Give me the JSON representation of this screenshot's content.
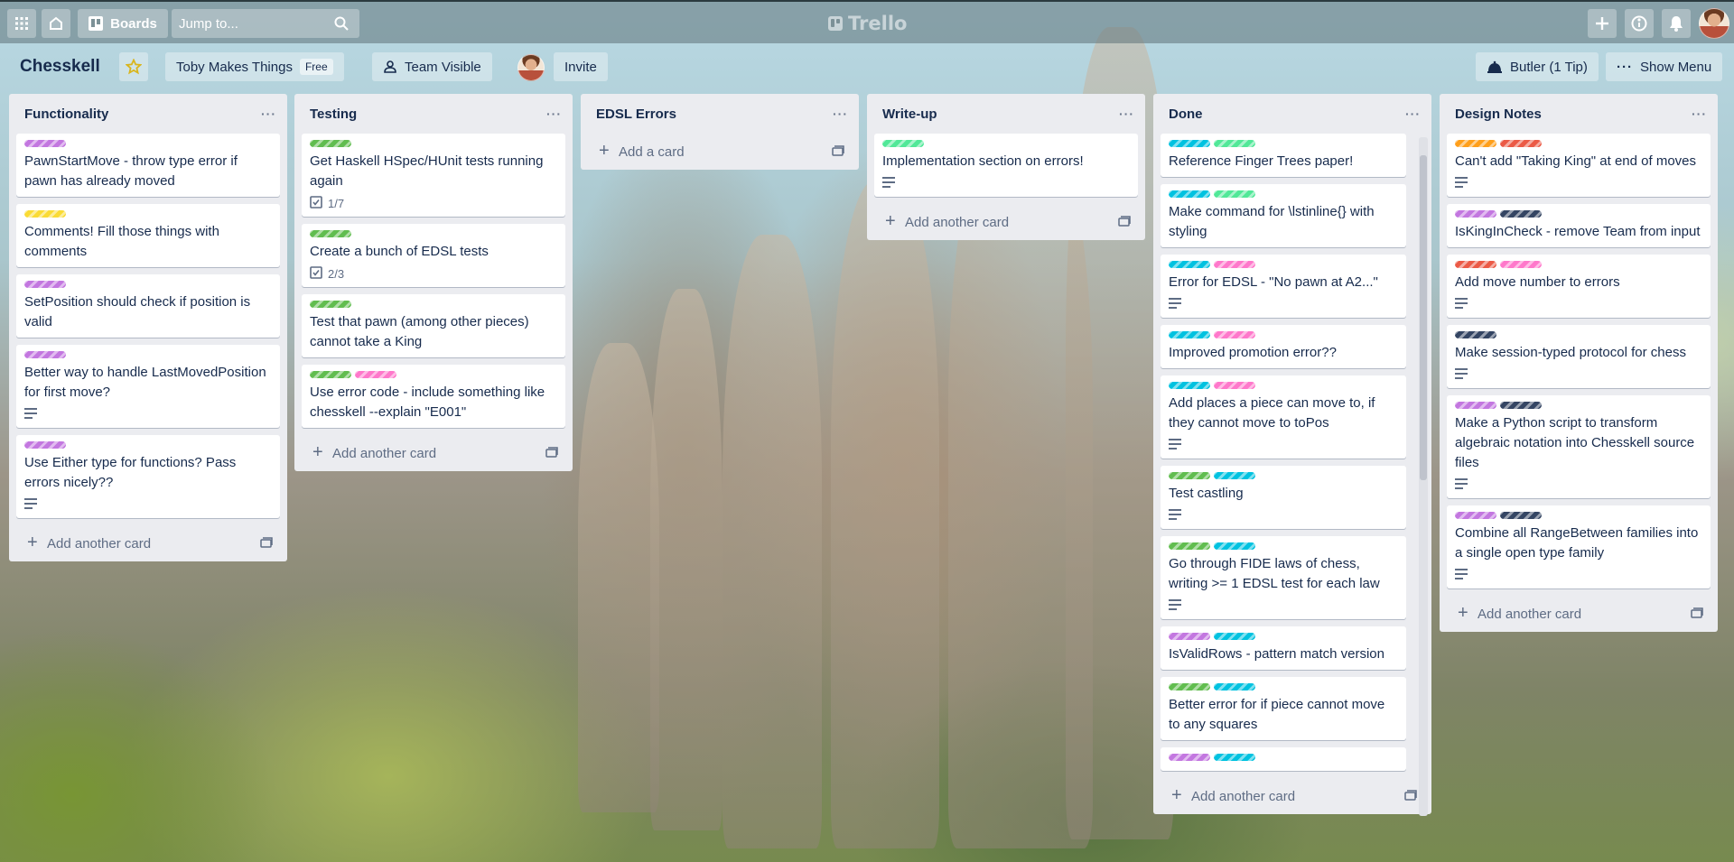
{
  "header": {
    "boards_label": "Boards",
    "search_placeholder": "Jump to...",
    "logo": "Trello"
  },
  "board": {
    "title": "Chesskell",
    "team_name": "Toby Makes Things",
    "team_plan": "Free",
    "visibility": "Team Visible",
    "invite_label": "Invite",
    "butler_label": "Butler (1 Tip)",
    "show_menu_label": "Show Menu"
  },
  "label_colors": {
    "purple": "#c377e0",
    "yellow": "#fadb35",
    "green": "#61bd4f",
    "pink": "#ff78cb",
    "mint": "#51e898",
    "sky": "#00c2e0",
    "navy": "#344563",
    "orange": "#ff9f1a",
    "red": "#eb5a46"
  },
  "lists": [
    {
      "title": "Functionality",
      "add_label": "Add another card",
      "cards": [
        {
          "labels": [
            "purple"
          ],
          "title": "PawnStartMove - throw type error if pawn has already moved"
        },
        {
          "labels": [
            "yellow"
          ],
          "title": "Comments! Fill those things with comments"
        },
        {
          "labels": [
            "purple"
          ],
          "title": "SetPosition should check if position is valid"
        },
        {
          "labels": [
            "purple"
          ],
          "title": "Better way to handle LastMovedPosition for first move?",
          "description": true
        },
        {
          "labels": [
            "purple"
          ],
          "title": "Use Either type for functions? Pass errors nicely??",
          "description": true
        }
      ]
    },
    {
      "title": "Testing",
      "add_label": "Add another card",
      "cards": [
        {
          "labels": [
            "green"
          ],
          "title": "Get Haskell HSpec/HUnit tests running again",
          "checklist": "1/7"
        },
        {
          "labels": [
            "green"
          ],
          "title": "Create a bunch of EDSL tests",
          "checklist": "2/3"
        },
        {
          "labels": [
            "green"
          ],
          "title": "Test that pawn (among other pieces) cannot take a King"
        },
        {
          "labels": [
            "green",
            "pink"
          ],
          "title": "Use error code - include something like chesskell --explain \"E001\""
        }
      ]
    },
    {
      "title": "EDSL Errors",
      "add_label": "Add a card",
      "cards": []
    },
    {
      "title": "Write-up",
      "add_label": "Add another card",
      "cards": [
        {
          "labels": [
            "mint"
          ],
          "title": "Implementation section on errors!",
          "description": true
        }
      ]
    },
    {
      "title": "Done",
      "add_label": "Add another card",
      "cards": [
        {
          "labels": [
            "sky",
            "mint"
          ],
          "title": "Reference Finger Trees paper!"
        },
        {
          "labels": [
            "sky",
            "mint"
          ],
          "title": "Make command for \\lstinline{} with styling"
        },
        {
          "labels": [
            "sky",
            "pink"
          ],
          "title": "Error for EDSL - \"No pawn at A2...\"",
          "description": true
        },
        {
          "labels": [
            "sky",
            "pink"
          ],
          "title": "Improved promotion error??"
        },
        {
          "labels": [
            "sky",
            "pink"
          ],
          "title": "Add places a piece can move to, if they cannot move to toPos",
          "description": true
        },
        {
          "labels": [
            "green",
            "sky"
          ],
          "title": "Test castling",
          "description": true
        },
        {
          "labels": [
            "green",
            "sky"
          ],
          "title": "Go through FIDE laws of chess, writing >= 1 EDSL test for each law",
          "description": true
        },
        {
          "labels": [
            "purple",
            "sky"
          ],
          "title": "IsValidRows - pattern match version"
        },
        {
          "labels": [
            "green",
            "sky"
          ],
          "title": "Better error for if piece cannot move to any squares"
        },
        {
          "labels": [
            "purple",
            "sky"
          ],
          "title": ""
        }
      ]
    },
    {
      "title": "Design Notes",
      "add_label": "Add another card",
      "cards": [
        {
          "labels": [
            "orange",
            "red"
          ],
          "title": "Can't add \"Taking King\" at end of moves",
          "description": true
        },
        {
          "labels": [
            "purple",
            "navy"
          ],
          "title": "IsKingInCheck - remove Team from input"
        },
        {
          "labels": [
            "red",
            "pink"
          ],
          "title": "Add move number to errors",
          "description": true
        },
        {
          "labels": [
            "navy"
          ],
          "title": "Make session-typed protocol for chess",
          "description": true
        },
        {
          "labels": [
            "purple",
            "navy"
          ],
          "title": "Make a Python script to transform algebraic notation into Chesskell source files",
          "description": true
        },
        {
          "labels": [
            "purple",
            "navy"
          ],
          "title": "Combine all RangeBetween families into a single open type family",
          "description": true
        }
      ]
    }
  ]
}
